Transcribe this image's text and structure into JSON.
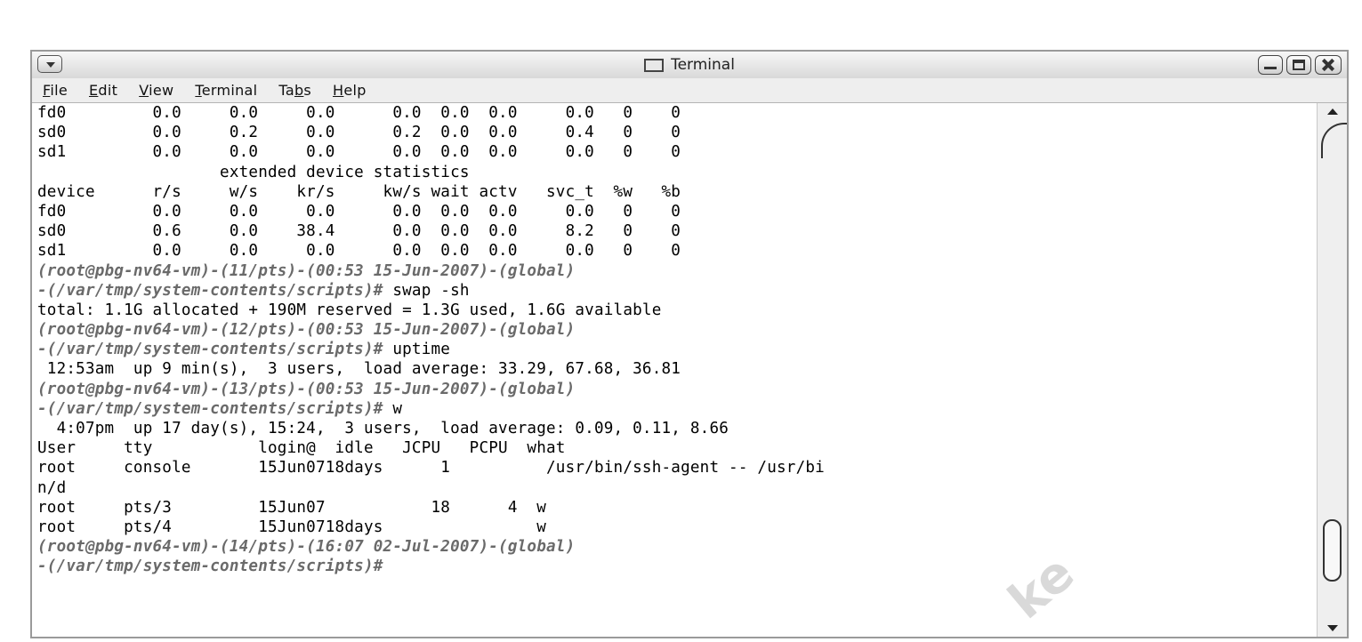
{
  "window": {
    "title": "Terminal"
  },
  "menubar": {
    "items": [
      {
        "pre": "",
        "u": "F",
        "rest": "ile"
      },
      {
        "pre": "",
        "u": "E",
        "rest": "dit"
      },
      {
        "pre": "",
        "u": "V",
        "rest": "iew"
      },
      {
        "pre": "",
        "u": "T",
        "rest": "erminal"
      },
      {
        "pre": "Ta",
        "u": "b",
        "rest": "s"
      },
      {
        "pre": "",
        "u": "H",
        "rest": "elp"
      }
    ]
  },
  "terminal": {
    "lines": [
      {
        "text": "fd0         0.0     0.0     0.0      0.0  0.0  0.0     0.0   0    0",
        "prompt": false
      },
      {
        "text": "sd0         0.0     0.2     0.0      0.2  0.0  0.0     0.4   0    0",
        "prompt": false
      },
      {
        "text": "sd1         0.0     0.0     0.0      0.0  0.0  0.0     0.0   0    0",
        "prompt": false
      },
      {
        "text": "                   extended device statistics",
        "prompt": false
      },
      {
        "text": "device      r/s     w/s    kr/s     kw/s wait actv   svc_t  %w   %b",
        "prompt": false
      },
      {
        "text": "fd0         0.0     0.0     0.0      0.0  0.0  0.0     0.0   0    0",
        "prompt": false
      },
      {
        "text": "sd0         0.6     0.0    38.4      0.0  0.0  0.0     8.2   0    0",
        "prompt": false
      },
      {
        "text": "sd1         0.0     0.0     0.0      0.0  0.0  0.0     0.0   0    0",
        "prompt": false
      },
      {
        "text": "(root@pbg-nv64-vm)-(11/pts)-(00:53 15-Jun-2007)-(global)",
        "prompt": true
      },
      {
        "text": "-(/var/tmp/system-contents/scripts)# ",
        "prompt": true,
        "cmd": "swap -sh"
      },
      {
        "text": "total: 1.1G allocated + 190M reserved = 1.3G used, 1.6G available",
        "prompt": false
      },
      {
        "text": "(root@pbg-nv64-vm)-(12/pts)-(00:53 15-Jun-2007)-(global)",
        "prompt": true
      },
      {
        "text": "-(/var/tmp/system-contents/scripts)# ",
        "prompt": true,
        "cmd": "uptime"
      },
      {
        "text": " 12:53am  up 9 min(s),  3 users,  load average: 33.29, 67.68, 36.81",
        "prompt": false
      },
      {
        "text": "(root@pbg-nv64-vm)-(13/pts)-(00:53 15-Jun-2007)-(global)",
        "prompt": true
      },
      {
        "text": "-(/var/tmp/system-contents/scripts)# ",
        "prompt": true,
        "cmd": "w"
      },
      {
        "text": "  4:07pm  up 17 day(s), 15:24,  3 users,  load average: 0.09, 0.11, 8.66",
        "prompt": false
      },
      {
        "text": "User     tty           login@  idle   JCPU   PCPU  what",
        "prompt": false
      },
      {
        "text": "root     console       15Jun0718days      1          /usr/bin/ssh-agent -- /usr/bi",
        "prompt": false
      },
      {
        "text": "n/d",
        "prompt": false
      },
      {
        "text": "root     pts/3         15Jun07           18      4  w",
        "prompt": false
      },
      {
        "text": "root     pts/4         15Jun0718days                w",
        "prompt": false
      },
      {
        "text": "(root@pbg-nv64-vm)-(14/pts)-(16:07 02-Jul-2007)-(global)",
        "prompt": true
      },
      {
        "text": "-(/var/tmp/system-contents/scripts)#",
        "prompt": true
      }
    ]
  },
  "watermark": "ke"
}
